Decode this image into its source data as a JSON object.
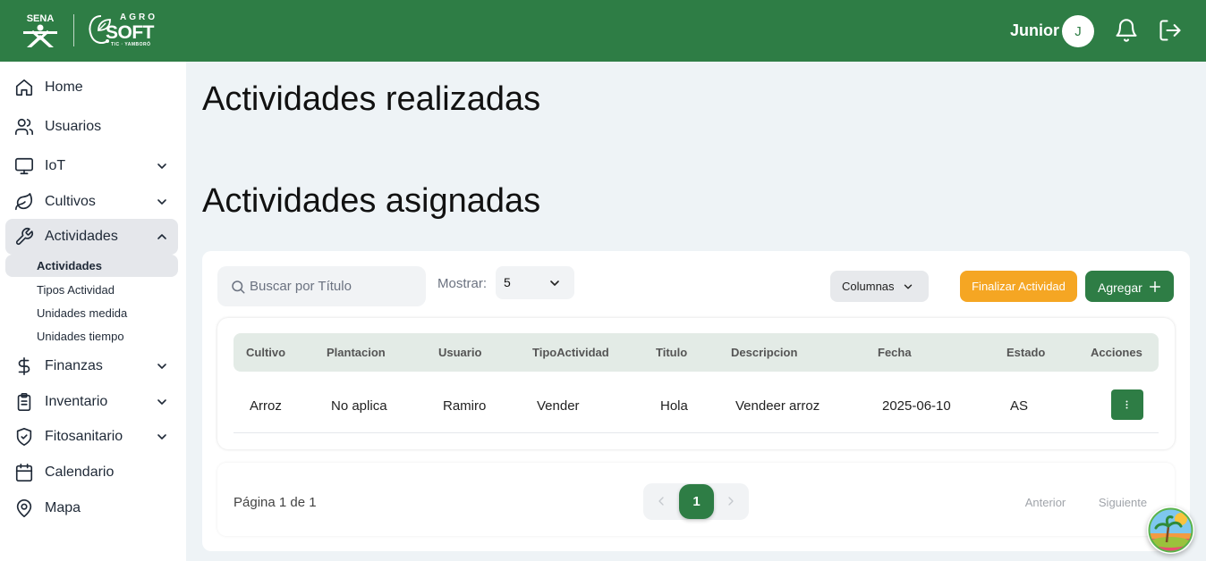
{
  "header": {
    "logo_sena": "SENA",
    "logo_agro": "AGRO",
    "logo_soft": "SOFT",
    "logo_tic": "TIC · YAMBORÓ",
    "user_name": "Junior",
    "avatar_initial": "J",
    "bg_color": "#2e7d45",
    "icons": [
      "bell-icon",
      "logout-icon"
    ]
  },
  "sidebar": {
    "items": [
      {
        "label": "Home",
        "icon": "home-icon"
      },
      {
        "label": "Usuarios",
        "icon": "users-icon"
      },
      {
        "label": "IoT",
        "icon": "monitor-icon",
        "expandable": true
      },
      {
        "label": "Cultivos",
        "icon": "leaf-icon",
        "expandable": true
      },
      {
        "label": "Actividades",
        "icon": "wrench-icon",
        "expandable": true,
        "expanded": true,
        "active": true
      },
      {
        "label": "Finanzas",
        "icon": "dollar-icon",
        "expandable": true
      },
      {
        "label": "Inventario",
        "icon": "clipboard-icon",
        "expandable": true
      },
      {
        "label": "Fitosanitario",
        "icon": "shield-icon",
        "expandable": true
      },
      {
        "label": "Calendario",
        "icon": "calendar-icon"
      },
      {
        "label": "Mapa",
        "icon": "map-pin-icon"
      }
    ],
    "subitems": [
      {
        "label": "Actividades",
        "active": true
      },
      {
        "label": "Tipos Actividad"
      },
      {
        "label": "Unidades medida"
      },
      {
        "label": "Unidades tiempo"
      }
    ]
  },
  "main": {
    "title_done": "Actividades realizadas",
    "title_assigned": "Actividades asignadas",
    "search_placeholder": "Buscar por Título",
    "show_label": "Mostrar:",
    "show_value": "5",
    "columns_label": "Columnas",
    "finish_label": "Finalizar Actividad",
    "add_label": "Agregar",
    "table": {
      "headers": [
        "Cultivo",
        "Plantacion",
        "Usuario",
        "TipoActividad",
        "Titulo",
        "Descripcion",
        "Fecha",
        "Estado",
        "Acciones"
      ],
      "rows": [
        [
          "Arroz",
          "No aplica",
          "Ramiro",
          "Vender",
          "Hola",
          "Vendeer arroz",
          "2025-06-10",
          "AS"
        ]
      ]
    },
    "pagination": {
      "info": "Página 1 de 1",
      "current_page": "1",
      "prev_label": "Anterior",
      "next_label": "Siguiente"
    },
    "accent_color": "#2e7d45",
    "warning_color": "#f5a623"
  }
}
